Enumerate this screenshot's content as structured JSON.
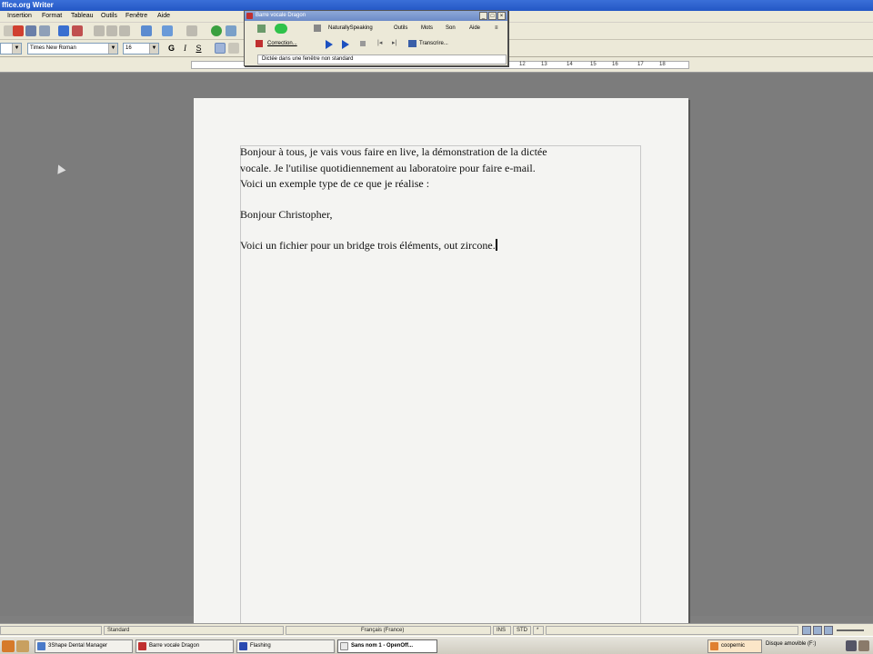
{
  "window": {
    "title": "ffice.org Writer"
  },
  "menu": [
    "Insertion",
    "Format",
    "Tableau",
    "Outils",
    "Fenêtre",
    "Aide"
  ],
  "format_toolbar": {
    "style_value": "",
    "font_value": "Times New Roman",
    "size_value": "16",
    "bold": "G",
    "italic": "I",
    "underline": "S"
  },
  "ruler": {
    "ticks": [
      "12",
      "13",
      "14",
      "15",
      "16",
      "17",
      "18"
    ]
  },
  "dragon_bar": {
    "title": "Barre vocale Dragon",
    "menus": [
      "NaturallySpeaking",
      "Outils",
      "Mots",
      "Son",
      "Aide"
    ],
    "correction_label": "Correction...",
    "transcribe_label": "Transcrire...",
    "tip": "Dictée dans une fenêtre non standard"
  },
  "document": {
    "lines": [
      "Bonjour à tous, je vais vous faire en live, la démonstration de la dictée",
      "vocale. Je l'utilise quotidiennement au laboratoire pour faire e-mail.",
      " Voici un exemple type de ce que je réalise :",
      "Bonjour Christopher,",
      "Voici un fichier pour un bridge trois éléments, out zircone."
    ]
  },
  "statusbar": {
    "style": "Standard",
    "language": "Français (France)",
    "ins": "INS",
    "std": "STD",
    "star": "*"
  },
  "taskbar": {
    "tasks": [
      "3Shape Dental Manager",
      "Barre vocale Dragon",
      "Flashing",
      "Sans nom 1 - OpenOff..."
    ],
    "tray_item": "coopernic",
    "tray_text": "Disque amovible (F:)"
  },
  "colors": {
    "title_bar": "#2457c5",
    "desktop": "#7c7c7c",
    "page": "#f4f4f2"
  }
}
